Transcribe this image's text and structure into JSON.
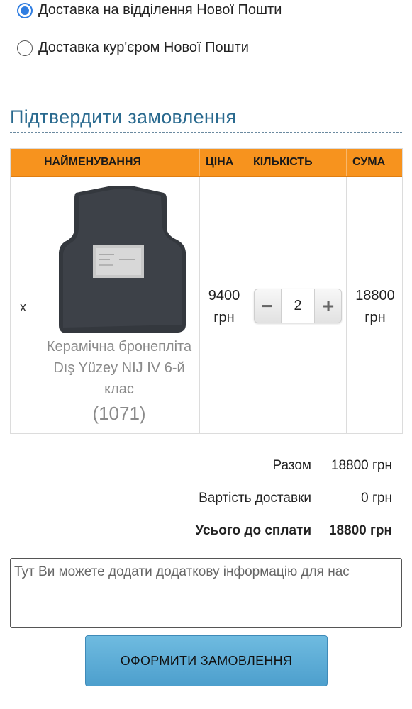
{
  "delivery_options": [
    {
      "label": "Доставка на відділення Нової Пошти",
      "selected": true
    },
    {
      "label": "Доставка кур'єром Нової Пошти",
      "selected": false
    }
  ],
  "section_title": "Підтвердити замовлення",
  "table": {
    "headers": [
      "",
      "НАЙМЕНУВАННЯ",
      "ЦІНА",
      "КІЛЬКІСТЬ",
      "СУМА"
    ],
    "header_color": "#f7931e",
    "row": {
      "remove": "x",
      "product_name": "Керамічна бронепліта Dış Yüzey NIJ IV 6-й клас",
      "product_code": "(1071)",
      "price_value": "9400",
      "price_currency": "грн",
      "quantity": "2",
      "minus_symbol": "−",
      "plus_symbol": "+",
      "sum_value": "18800",
      "sum_currency": "грн"
    }
  },
  "totals": {
    "subtotal_label": "Разом",
    "subtotal_value": "18800 грн",
    "delivery_label": "Вартість доставки",
    "delivery_value": "0 грн",
    "total_label": "Усього до сплати",
    "total_value": "18800 грн"
  },
  "comment_placeholder": "Тут Ви можете додати додаткову інформацію для нас",
  "submit_label": "ОФОРМИТИ ЗАМОВЛЕННЯ",
  "accent_colors": {
    "title": "#2a6a8f",
    "button": "#5aaad6",
    "radio": "#2f7de1"
  }
}
